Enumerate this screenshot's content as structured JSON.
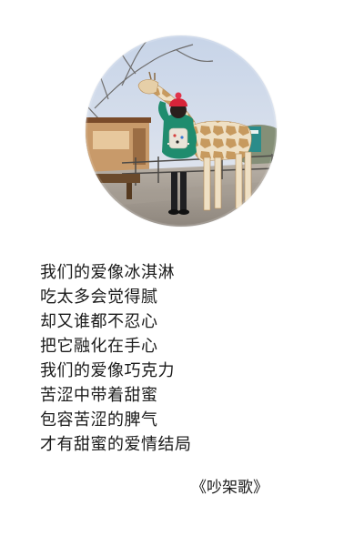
{
  "photo": {
    "subject": "girl-with-giraffe-photo"
  },
  "poem": {
    "lines": [
      "我们的爱像冰淇淋",
      "吃太多会觉得腻",
      "却又谁都不忍心",
      "把它融化在手心",
      "我们的爱像巧克力",
      "苦涩中带着甜蜜",
      "包容苦涩的脾气",
      "才有甜蜜的爱情结局"
    ]
  },
  "song_title": "《吵架歌》"
}
